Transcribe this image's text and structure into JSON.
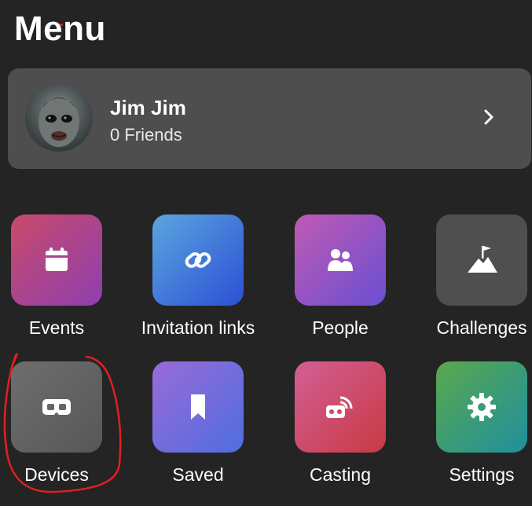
{
  "header": {
    "title": "Menu"
  },
  "profile": {
    "name": "Jim Jim",
    "friends": "0 Friends"
  },
  "tiles": [
    {
      "label": "Events",
      "icon": "calendar-icon",
      "gradient": [
        "#c94a6a",
        "#8e3fb0"
      ]
    },
    {
      "label": "Invitation links",
      "icon": "link-icon",
      "gradient": [
        "#5aa6dd",
        "#2d4fd6"
      ]
    },
    {
      "label": "People",
      "icon": "people-icon",
      "gradient": [
        "#c05ab3",
        "#6a4fd2"
      ]
    },
    {
      "label": "Challenges",
      "icon": "mountain-flag-icon",
      "gradient": [
        "#4f4f4f",
        "#4f4f4f"
      ]
    },
    {
      "label": "Devices",
      "icon": "vr-headset-icon",
      "gradient": [
        "#6e6e6e",
        "#575757"
      ]
    },
    {
      "label": "Saved",
      "icon": "bookmark-icon",
      "gradient": [
        "#9a6ad8",
        "#4e6ee0"
      ]
    },
    {
      "label": "Casting",
      "icon": "casting-icon",
      "gradient": [
        "#d35e95",
        "#c83a43"
      ]
    },
    {
      "label": "Settings",
      "icon": "gear-icon",
      "gradient": [
        "#5aa84d",
        "#1f8f9e"
      ]
    }
  ],
  "colors": {
    "background": "#242424",
    "card": "#4e4e4e",
    "text": "#ffffff",
    "annotation": "#e02020"
  }
}
